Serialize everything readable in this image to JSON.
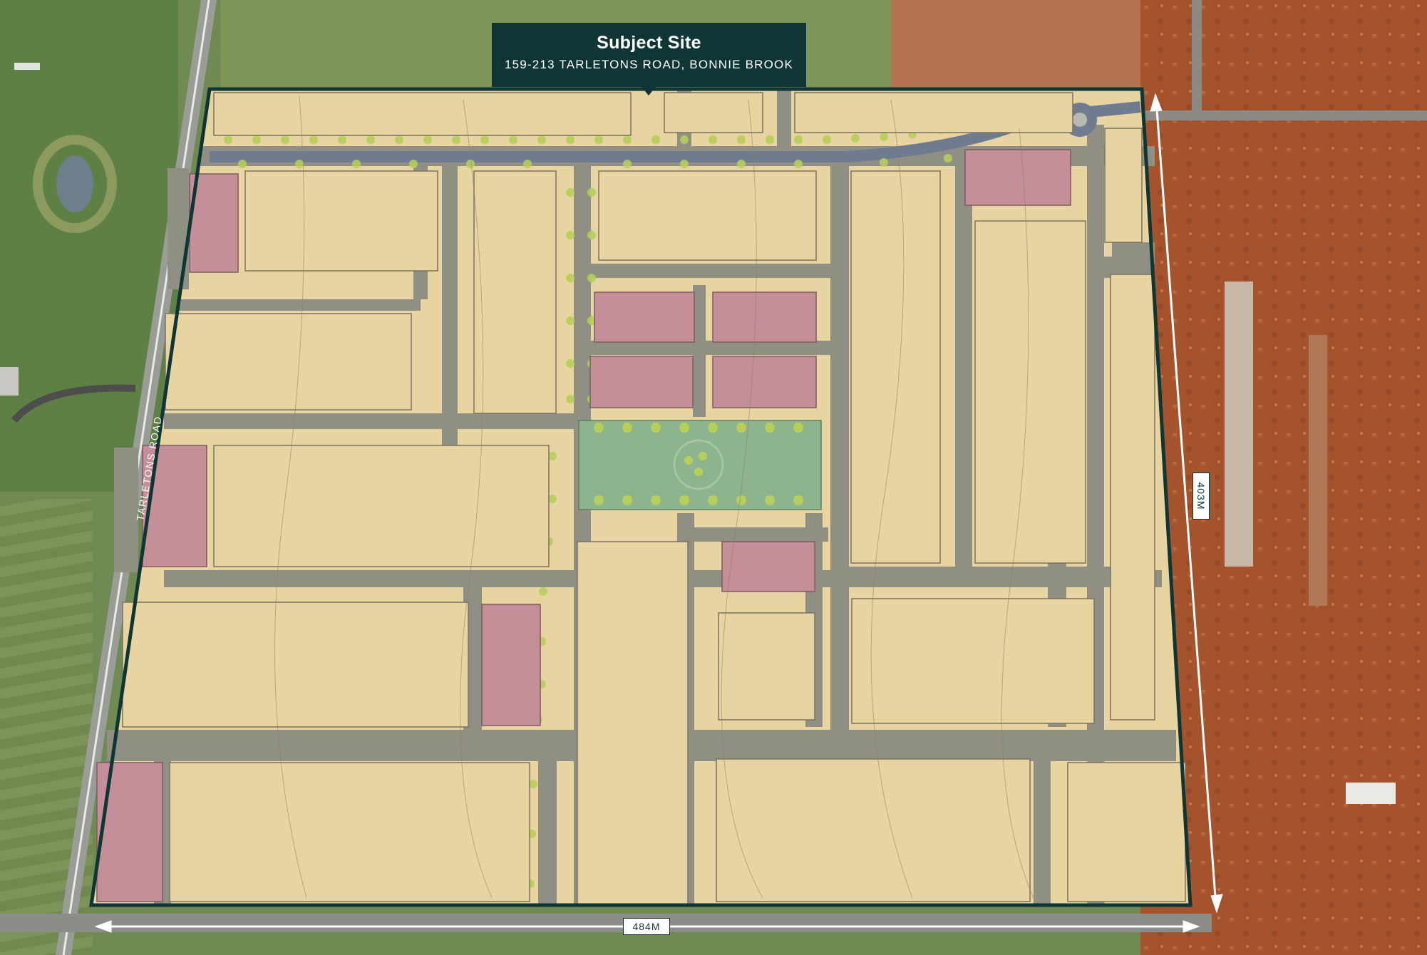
{
  "callout": {
    "title": "Subject Site",
    "address": "159-213 TARLETONS ROAD, BONNIE BROOK"
  },
  "road_label": "TARLETONS ROAD",
  "dimensions": {
    "width": "484M",
    "height": "403M"
  },
  "colors": {
    "boundary": "#0f3634",
    "lot_residential": "#e7d4a0",
    "lot_commercial": "#c48f98",
    "open_space": "#8db48d",
    "road": "#8f8f84",
    "farmland": "#6f8a52",
    "construction_soil": "#a9552e",
    "street_trees": "#b6cf5a"
  }
}
